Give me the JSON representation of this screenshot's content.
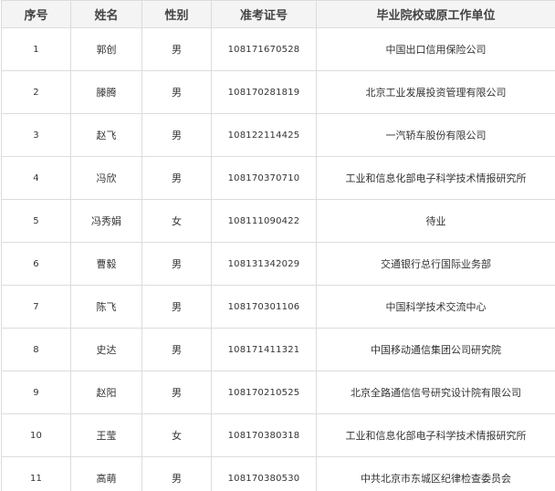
{
  "table": {
    "headers": {
      "index": "序号",
      "name": "姓名",
      "gender": "性别",
      "exam_no": "准考证号",
      "org": "毕业院校或原工作单位"
    },
    "rows": [
      {
        "index": "1",
        "name": "郭创",
        "gender": "男",
        "exam_no": "108171670528",
        "org": "中国出口信用保险公司"
      },
      {
        "index": "2",
        "name": "滕腾",
        "gender": "男",
        "exam_no": "108170281819",
        "org": "北京工业发展投资管理有限公司"
      },
      {
        "index": "3",
        "name": "赵飞",
        "gender": "男",
        "exam_no": "108122114425",
        "org": "一汽轿车股份有限公司"
      },
      {
        "index": "4",
        "name": "冯欣",
        "gender": "男",
        "exam_no": "108170370710",
        "org": "工业和信息化部电子科学技术情报研究所"
      },
      {
        "index": "5",
        "name": "冯秀娟",
        "gender": "女",
        "exam_no": "108111090422",
        "org": "待业"
      },
      {
        "index": "6",
        "name": "曹毅",
        "gender": "男",
        "exam_no": "108131342029",
        "org": "交通银行总行国际业务部"
      },
      {
        "index": "7",
        "name": "陈飞",
        "gender": "男",
        "exam_no": "108170301106",
        "org": "中国科学技术交流中心"
      },
      {
        "index": "8",
        "name": "史达",
        "gender": "男",
        "exam_no": "108171411321",
        "org": "中国移动通信集团公司研究院"
      },
      {
        "index": "9",
        "name": "赵阳",
        "gender": "男",
        "exam_no": "108170210525",
        "org": "北京全路通信信号研究设计院有限公司"
      },
      {
        "index": "10",
        "name": "王莹",
        "gender": "女",
        "exam_no": "108170380318",
        "org": "工业和信息化部电子科学技术情报研究所"
      },
      {
        "index": "11",
        "name": "高萌",
        "gender": "男",
        "exam_no": "108170380530",
        "org": "中共北京市东城区纪律检查委员会"
      }
    ]
  }
}
